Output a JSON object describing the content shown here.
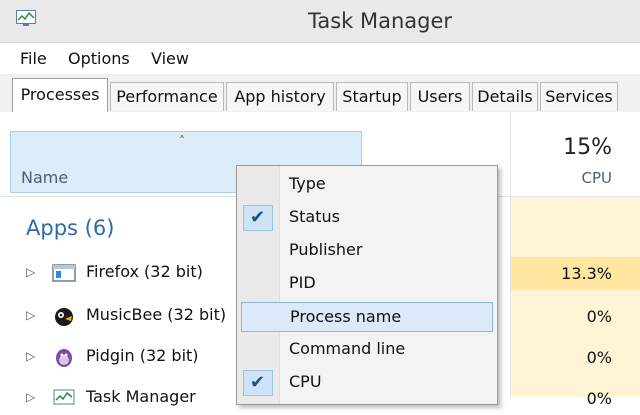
{
  "window": {
    "title": "Task Manager",
    "app_icon": "task-manager-icon"
  },
  "menu": [
    "File",
    "Options",
    "View"
  ],
  "tabs": [
    {
      "label": "Processes",
      "active": true
    },
    {
      "label": "Performance"
    },
    {
      "label": "App history"
    },
    {
      "label": "Startup"
    },
    {
      "label": "Users"
    },
    {
      "label": "Details"
    },
    {
      "label": "Services"
    }
  ],
  "columns": {
    "name": {
      "label": "Name",
      "sort_indicator": "˄"
    },
    "cpu": {
      "label": "CPU",
      "total": "15%"
    }
  },
  "groups": {
    "apps": "Apps (6)"
  },
  "processes": [
    {
      "name": "Firefox (32 bit)",
      "cpu": "13.3%",
      "icon": "firefox-icon"
    },
    {
      "name": "MusicBee (32 bit)",
      "cpu": "0%",
      "icon": "musicbee-icon"
    },
    {
      "name": "Pidgin (32 bit)",
      "cpu": "0%",
      "icon": "pidgin-icon"
    },
    {
      "name": "Task Manager",
      "cpu": "0%",
      "icon": "task-manager-icon"
    }
  ],
  "context_menu": [
    {
      "label": "Type",
      "checked": false
    },
    {
      "label": "Status",
      "checked": true
    },
    {
      "label": "Publisher",
      "checked": false
    },
    {
      "label": "PID",
      "checked": false
    },
    {
      "label": "Process name",
      "checked": false,
      "highlighted": true
    },
    {
      "label": "Command line",
      "checked": false
    },
    {
      "label": "CPU",
      "checked": true
    }
  ],
  "colors": {
    "cpu_heat_high": "#ffe7a2",
    "cpu_heat_low": "#fff5d6",
    "selection": "#dcecf9",
    "group_text": "#2d6aa8"
  }
}
